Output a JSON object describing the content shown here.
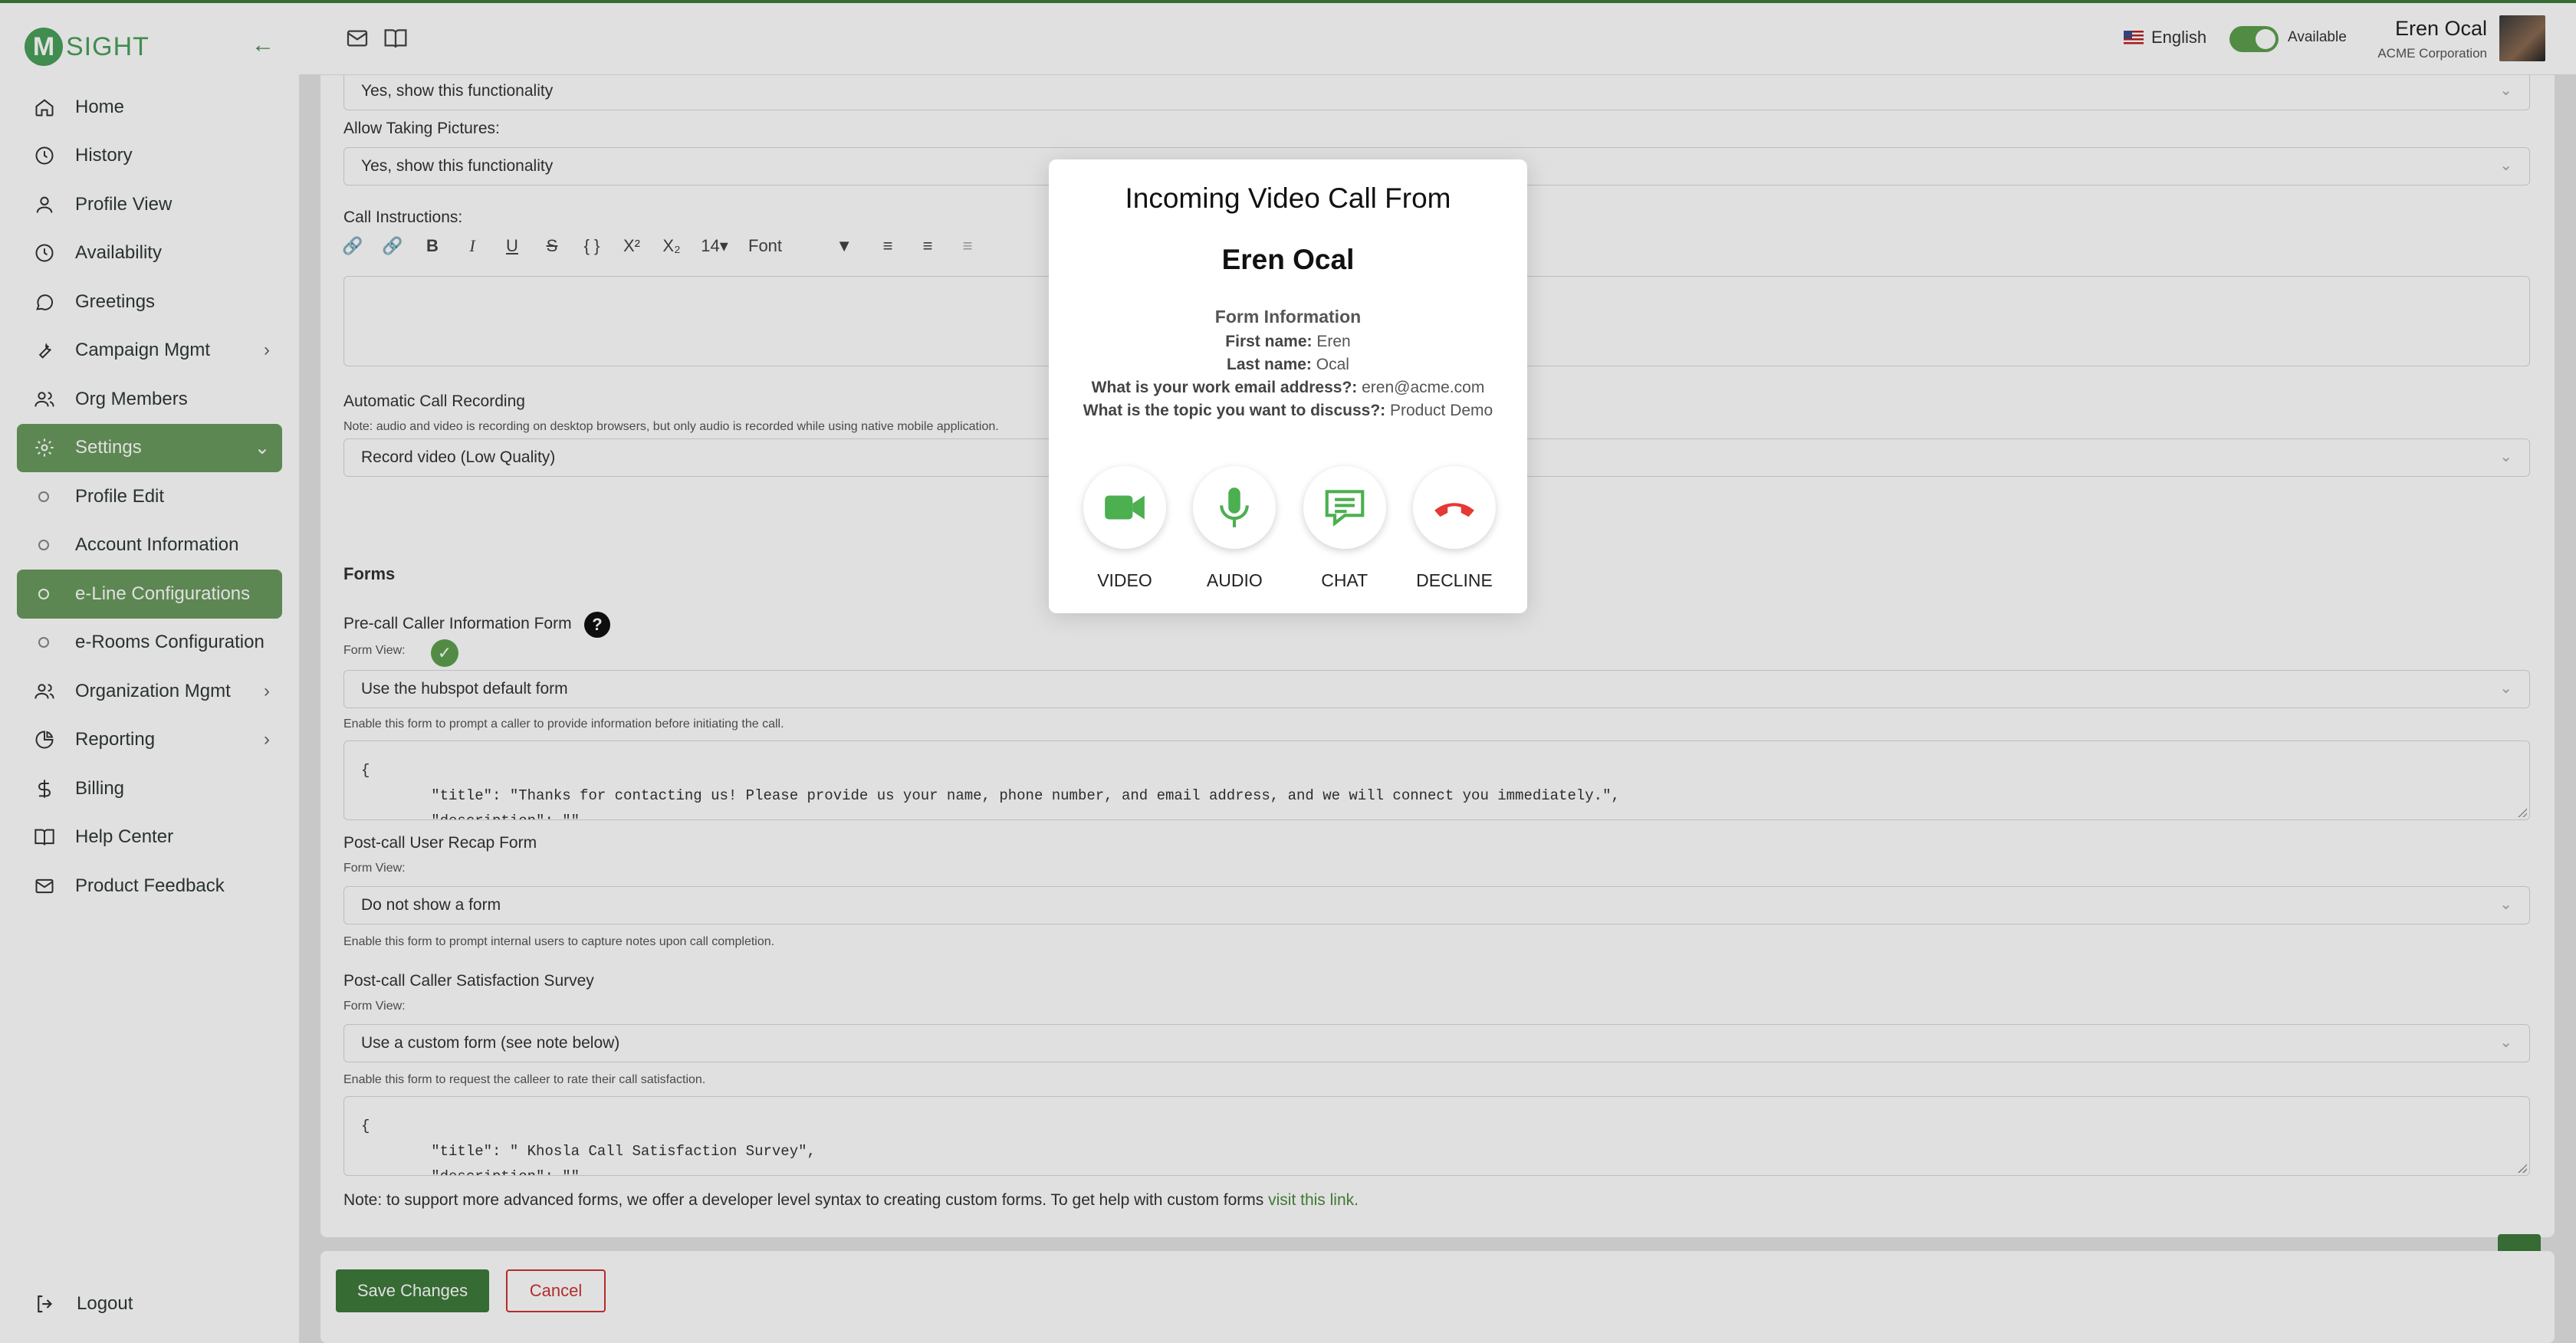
{
  "brand": {
    "logo_letter": "M",
    "logo_text": "SIGHT"
  },
  "sidebar": {
    "items": [
      {
        "label": "Home",
        "icon": "home-icon"
      },
      {
        "label": "History",
        "icon": "clock-icon"
      },
      {
        "label": "Profile View",
        "icon": "user-icon"
      },
      {
        "label": "Availability",
        "icon": "clock-icon"
      },
      {
        "label": "Greetings",
        "icon": "chat-bubble-icon"
      },
      {
        "label": "Campaign Mgmt",
        "icon": "wrench-icon"
      },
      {
        "label": "Org Members",
        "icon": "users-icon"
      },
      {
        "label": "Settings",
        "icon": "gear-icon"
      },
      {
        "label": "Profile Edit"
      },
      {
        "label": "Account Information"
      },
      {
        "label": "e-Line Configurations"
      },
      {
        "label": "e-Rooms Configuration"
      },
      {
        "label": "Organization Mgmt",
        "icon": "users-icon"
      },
      {
        "label": "Reporting",
        "icon": "pie-chart-icon"
      },
      {
        "label": "Billing",
        "icon": "dollar-icon"
      },
      {
        "label": "Help Center",
        "icon": "book-icon"
      },
      {
        "label": "Product Feedback",
        "icon": "mail-icon"
      }
    ],
    "logout": "Logout"
  },
  "header": {
    "language": "English",
    "status": "Available",
    "user_name": "Eren Ocal",
    "user_org": "ACME Corporation"
  },
  "content": {
    "show_functionality_1": "Yes, show this functionality",
    "allow_pictures_label": "Allow Taking Pictures:",
    "show_functionality_2": "Yes, show this functionality",
    "call_instructions_label": "Call Instructions:",
    "toolbar": {
      "font_size": "14",
      "font": "Font"
    },
    "recording_label": "Automatic Call Recording",
    "recording_note": "Note: audio and video is recording on desktop browsers, but only audio is recorded while using native mobile application.",
    "recording_value": "Record video (Low Quality)",
    "forms_title": "Forms",
    "precall_label": "Pre-call Caller Information Form",
    "form_view_1": "Form View:",
    "precall_value": "Use the hubspot default form",
    "precall_help": "Enable this form to prompt a caller to provide information before initiating the call.",
    "precall_json": "{\n        \"title\": \"Thanks for contacting us! Please provide us your name, phone number, and email address, and we will connect you immediately.\",\n        \"description\": \"\"",
    "postcall_label": "Post-call User Recap Form",
    "form_view_2": "Form View:",
    "postcall_value": "Do not show a form",
    "postcall_help": "Enable this form to prompt internal users to capture notes upon call completion.",
    "survey_label": "Post-call Caller Satisfaction Survey",
    "form_view_3": "Form View:",
    "survey_value": "Use a custom form (see note below)",
    "survey_help": "Enable this form to request the calleer to rate their call satisfaction.",
    "survey_json": "{\n        \"title\": \" Khosla Call Satisfaction Survey\",\n        \"description\": \"\"",
    "note_text": "Note: to support more advanced forms, we offer a developer level syntax to creating custom forms. To get help with custom forms ",
    "note_link": "visit this link.",
    "save_label": "Save Changes",
    "cancel_label": "Cancel"
  },
  "modal": {
    "title": "Incoming Video Call From",
    "caller": "Eren Ocal",
    "form_header": "Form Information",
    "fields": [
      {
        "key": "First name:",
        "value": "Eren"
      },
      {
        "key": "Last name:",
        "value": "Ocal"
      },
      {
        "key": "What is your work email address?:",
        "value": "eren@acme.com"
      },
      {
        "key": "What is the topic you want to discuss?:",
        "value": "Product Demo"
      }
    ],
    "actions": {
      "video": "VIDEO",
      "audio": "AUDIO",
      "chat": "CHAT",
      "decline": "DECLINE"
    }
  },
  "colors": {
    "accent": "#3e7a3c",
    "sidebar_active": "#6a9a5e",
    "decline": "#e53935",
    "icon_green": "#4caf50"
  }
}
